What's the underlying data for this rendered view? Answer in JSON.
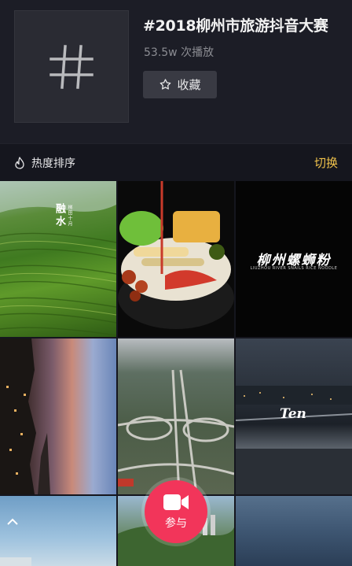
{
  "topic": {
    "title": "#2018柳州市旅游抖音大赛",
    "plays": "53.5w 次播放",
    "favorite_label": "收藏"
  },
  "sortbar": {
    "sort_label": "热度排序",
    "switch_label": "切换"
  },
  "videos": [
    {
      "overlay_title": "融水",
      "overlay_sub": "梯田十月"
    },
    {
      "overlay_title": ""
    },
    {
      "overlay_title": "柳州螺蛳粉",
      "overlay_sub": "LIUZHOU RIVER SNAILS RICE NOODLE"
    },
    {
      "overlay_title": ""
    },
    {
      "overlay_title": ""
    },
    {
      "overlay_title": "Ten"
    },
    {
      "overlay_title": ""
    },
    {
      "overlay_title": ""
    },
    {
      "overlay_title": ""
    }
  ],
  "join": {
    "label": "参与"
  },
  "colors": {
    "accent_switch": "#f0c24b",
    "join_button": "#f2355a"
  },
  "icons": {
    "topic": "hash-icon",
    "favorite": "star-outline-icon",
    "sort": "flame-icon",
    "join": "video-camera-icon"
  }
}
